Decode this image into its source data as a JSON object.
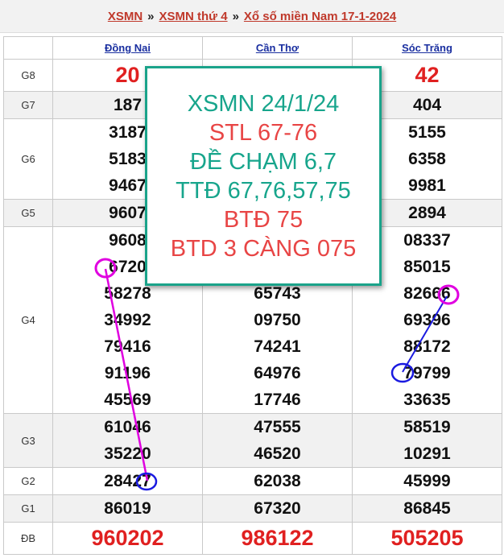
{
  "breadcrumb": {
    "link1": "XSMN",
    "sep": "»",
    "link2": "XSMN thứ 4",
    "link3": "Xổ số miền Nam 17-1-2024"
  },
  "table": {
    "provinces": [
      "Đồng Nai",
      "Cần Thơ",
      "Sóc Trăng"
    ],
    "rows": [
      {
        "label": "G8",
        "values": [
          [
            "20"
          ],
          [
            ""
          ],
          [
            "42"
          ]
        ]
      },
      {
        "label": "G7",
        "values": [
          [
            "187"
          ],
          [
            ""
          ],
          [
            "404"
          ]
        ]
      },
      {
        "label": "G6",
        "values": [
          [
            "3187",
            "5183",
            "9467"
          ],
          [
            "",
            "",
            ""
          ],
          [
            "5155",
            "6358",
            "9981"
          ]
        ]
      },
      {
        "label": "G5",
        "values": [
          [
            "9607"
          ],
          [
            ""
          ],
          [
            "2894"
          ]
        ]
      },
      {
        "label": "G4",
        "values": [
          [
            "9608",
            "6720",
            "58278",
            "34992",
            "79416",
            "91196",
            "45569"
          ],
          [
            "",
            "",
            "65743",
            "09750",
            "74241",
            "64976",
            "17746"
          ],
          [
            "08337",
            "85015",
            "82666",
            "69396",
            "88172",
            "79799",
            "33635"
          ]
        ]
      },
      {
        "label": "G3",
        "values": [
          [
            "61046",
            "35220"
          ],
          [
            "47555",
            "46520"
          ],
          [
            "58519",
            "10291"
          ]
        ]
      },
      {
        "label": "G2",
        "values": [
          [
            "28427"
          ],
          [
            "62038"
          ],
          [
            "45999"
          ]
        ]
      },
      {
        "label": "G1",
        "values": [
          [
            "86019"
          ],
          [
            "67320"
          ],
          [
            "86845"
          ]
        ]
      },
      {
        "label": "ĐB",
        "values": [
          [
            "960202"
          ],
          [
            "986122"
          ],
          [
            "505205"
          ]
        ]
      }
    ]
  },
  "overlay": {
    "lines": [
      "XSMN 24/1/24",
      "STL 67-76",
      "ĐỀ CHẠM 6,7",
      "TTĐ 67,76,57,75",
      "BTĐ 75",
      "BTD 3 CÀNG 075"
    ],
    "colors": [
      "#17a58c",
      "#e84545",
      "#17a58c",
      "#17a58c",
      "#e84545",
      "#e84545"
    ]
  }
}
